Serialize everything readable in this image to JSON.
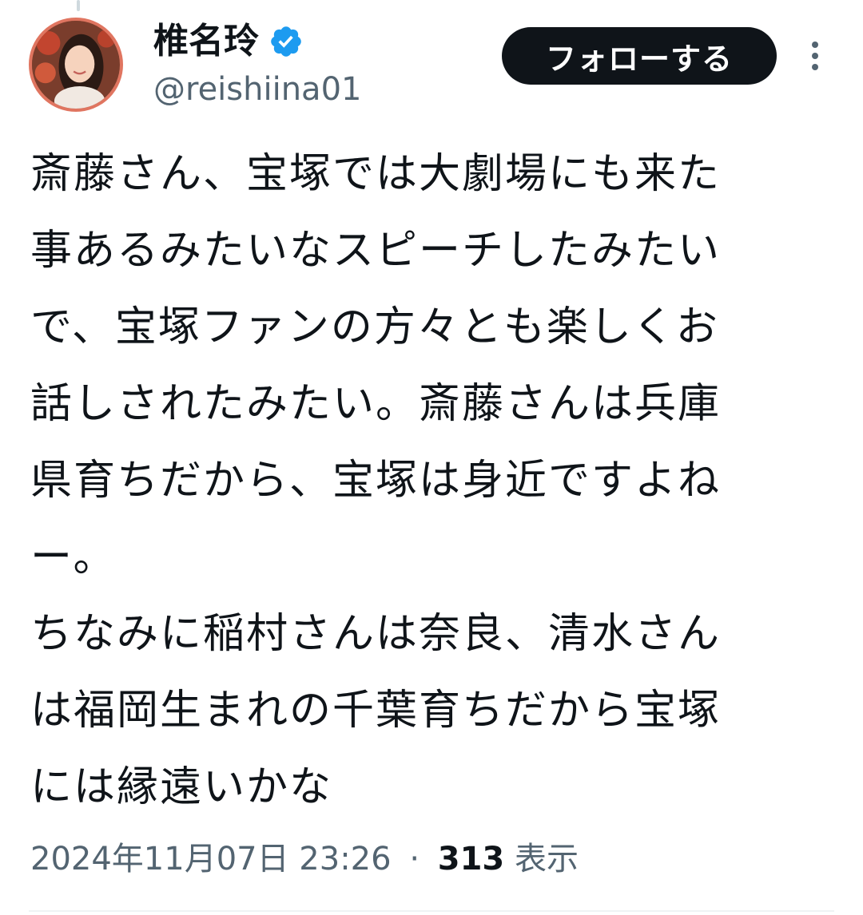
{
  "author": {
    "display_name": "椎名玲",
    "username": "@reishiina01",
    "verified_color": "#1d9bf0",
    "avatar_border_color": "#e07560"
  },
  "actions": {
    "follow_label": "フォローする",
    "more_icon": "more-vertical-icon"
  },
  "tweet": {
    "lines": [
      "斎藤さん、宝塚では大劇場にも来た",
      "事あるみたいなスピーチしたみたい",
      "で、宝塚ファンの方々とも楽しくお",
      "話しされたみたい。斎藤さんは兵庫",
      "県育ちだから、宝塚は身近ですよね",
      "ー。",
      "ちなみに稲村さんは奈良、清水さん",
      "は福岡生まれの千葉育ちだから宝塚",
      "には縁遠いかな"
    ],
    "timestamp": "2024年11月07日 23:26",
    "separator": "·",
    "views_count": "313",
    "views_label": "表示"
  }
}
